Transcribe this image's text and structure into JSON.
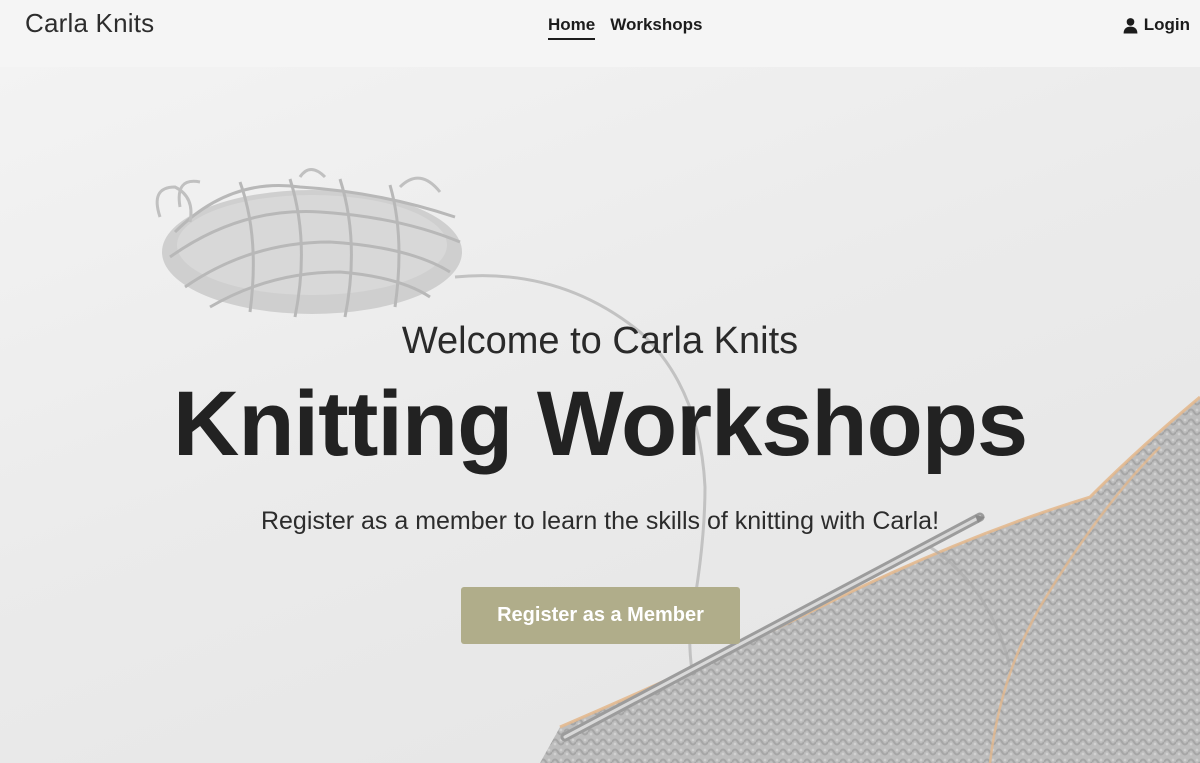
{
  "nav": {
    "brand": "Carla Knits",
    "links": [
      {
        "label": "Home",
        "active": true
      },
      {
        "label": "Workshops",
        "active": false
      }
    ],
    "login_label": "Login",
    "login_icon": "user-icon"
  },
  "hero": {
    "welcome": "Welcome to Carla Knits",
    "headline": "Knitting Workshops",
    "subline": "Register as a member to learn the skills of knitting with Carla!",
    "cta_label": "Register as a Member"
  },
  "colors": {
    "nav_bg": "#f5f5f5",
    "cta_bg": "#b0ad8a",
    "text": "#222222"
  }
}
